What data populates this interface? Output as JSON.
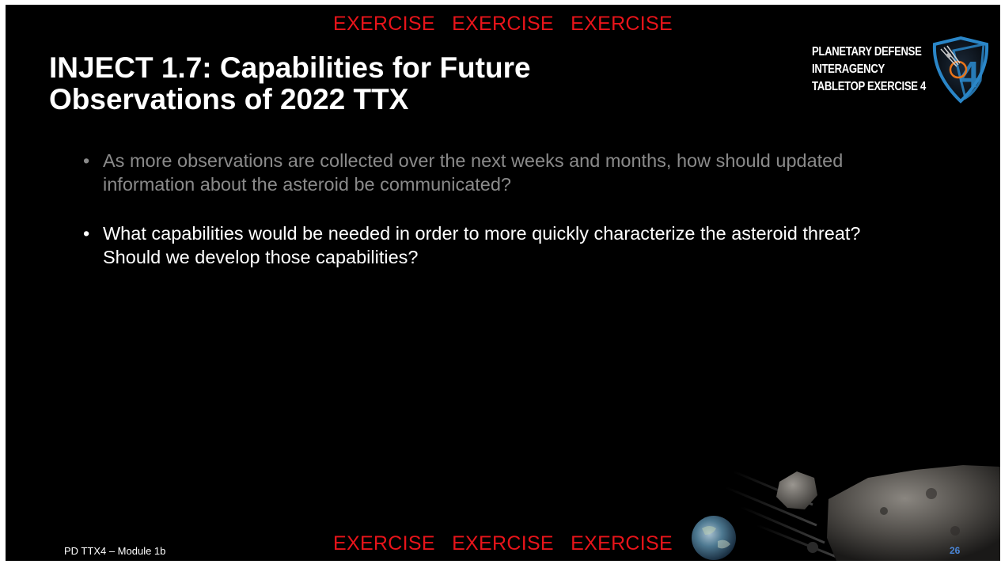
{
  "banner": {
    "top": "EXERCISE   EXERCISE   EXERCISE",
    "bottom": "EXERCISE   EXERCISE   EXERCISE"
  },
  "title": {
    "line1": "INJECT 1.7: Capabilities for Future",
    "line2": "Observations of 2022 TTX"
  },
  "logo": {
    "line1": "PLANETARY DEFENSE",
    "line2": "INTERAGENCY",
    "line3": "TABLETOP EXERCISE 4",
    "emblem_number": "4"
  },
  "bullets": [
    {
      "marker": "•",
      "text": "As more observations are collected over the next weeks and months, how should updated information about the asteroid be communicated?"
    },
    {
      "marker": "•",
      "text": "What capabilities would be needed in order to more quickly characterize the asteroid threat? Should we develop those capabilities?"
    }
  ],
  "footer": {
    "left": "PD TTX4 – Module 1b",
    "page_number": "26"
  },
  "colors": {
    "background": "#000000",
    "exercise_red": "#e8141a",
    "title": "#ffffff",
    "dimmed_bullet": "#8a8a8a",
    "page_number_blue": "#4a86d8",
    "shield_blue": "#2a86c8"
  }
}
